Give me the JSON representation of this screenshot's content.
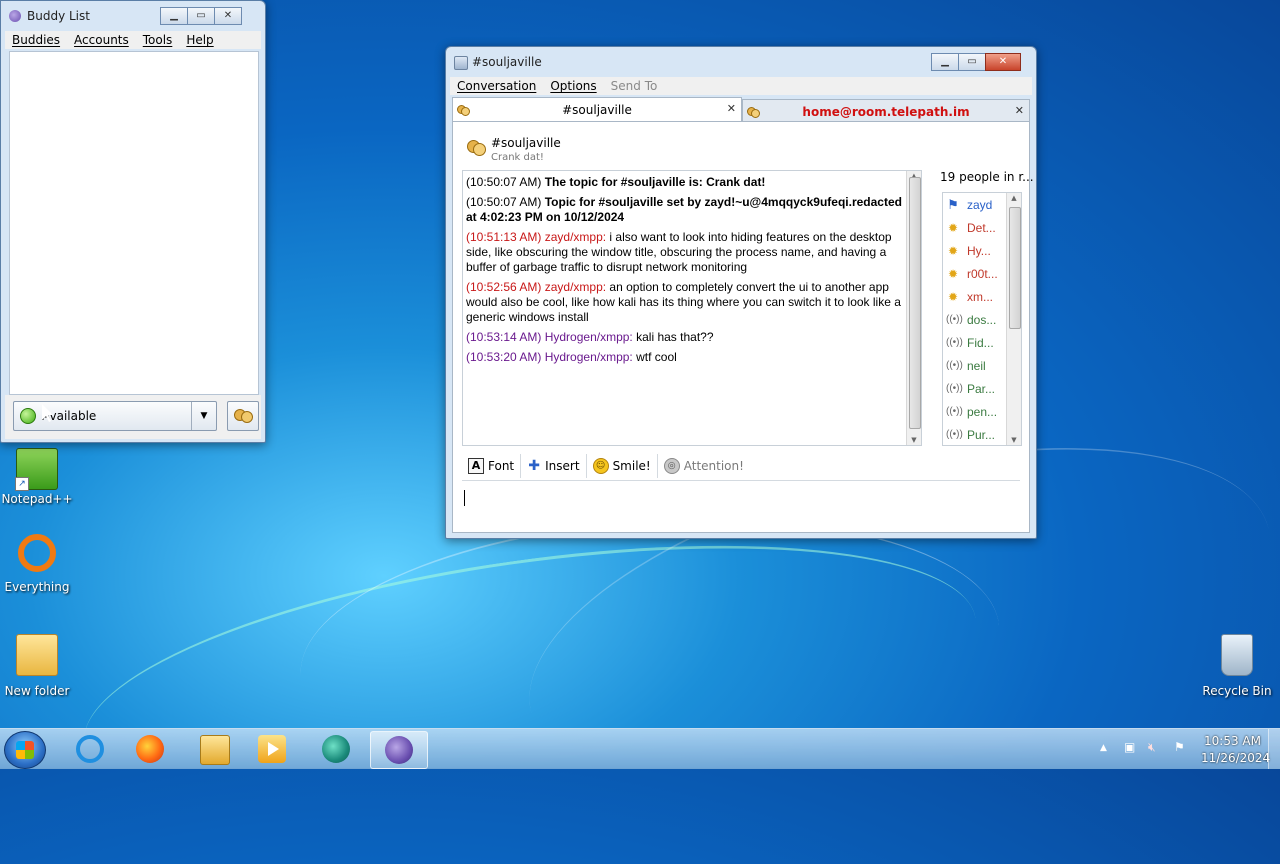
{
  "desktop": {
    "icons": [
      {
        "label": "Notepad++"
      },
      {
        "label": "Everything"
      },
      {
        "label": "New folder"
      },
      {
        "label": "Recycle Bin"
      }
    ]
  },
  "buddy_list": {
    "title": "Buddy List",
    "menu": [
      "Buddies",
      "Accounts",
      "Tools",
      "Help"
    ],
    "status": "Available"
  },
  "conversation": {
    "title": "#souljaville",
    "menu": {
      "conversation": "Conversation",
      "options": "Options",
      "send_to": "Send To"
    },
    "tabs": [
      {
        "label": "#souljaville",
        "active": true
      },
      {
        "label": "home@room.telepath.im",
        "active": false,
        "alert": true
      }
    ],
    "room": {
      "name": "#souljaville",
      "topic": "Crank dat!"
    },
    "messages": [
      {
        "time": "(10:50:07 AM)",
        "text": "The topic for #souljaville is: Crank dat!"
      },
      {
        "time": "(10:50:07 AM)",
        "text": "Topic for #souljaville set by zayd!~u@4mqqyck9ufeqi.redacted at 4:02:23 PM on 10/12/2024"
      },
      {
        "time": "(10:51:13 AM)",
        "nick": "zayd/xmpp:",
        "text": "i also want to look into hiding features on the desktop side, like obscuring the window title, obscuring the process name, and having a buffer of garbage traffic to disrupt network monitoring"
      },
      {
        "time": "(10:52:56 AM)",
        "nick": "zayd/xmpp:",
        "text": "an option to completely convert the ui to another app would also be cool, like how kali has its thing where you can switch it to look like a generic windows install"
      },
      {
        "time": "(10:53:14 AM)",
        "nick": "Hydrogen/xmpp:",
        "text": "kali has that??"
      },
      {
        "time": "(10:53:20 AM)",
        "nick": "Hydrogen/xmpp:",
        "text": "wtf cool"
      }
    ],
    "people_count": "19 people in r...",
    "people": [
      {
        "name": "zayd",
        "icon": "flag-icon"
      },
      {
        "name": "Det...",
        "icon": "star-icon"
      },
      {
        "name": "Hy...",
        "icon": "star-icon"
      },
      {
        "name": "r00t...",
        "icon": "star-icon"
      },
      {
        "name": "xm...",
        "icon": "star-icon"
      },
      {
        "name": "dos...",
        "icon": "signal-icon"
      },
      {
        "name": "Fid...",
        "icon": "signal-icon"
      },
      {
        "name": "neil",
        "icon": "signal-icon"
      },
      {
        "name": "Par...",
        "icon": "signal-icon"
      },
      {
        "name": "pen...",
        "icon": "signal-icon"
      },
      {
        "name": "Pur...",
        "icon": "signal-icon"
      }
    ],
    "toolbar": {
      "font": "Font",
      "insert": "Insert",
      "smile": "Smile!",
      "attention": "Attention!"
    }
  },
  "taskbar": {
    "time": "10:53 AM",
    "date": "11/26/2024"
  }
}
